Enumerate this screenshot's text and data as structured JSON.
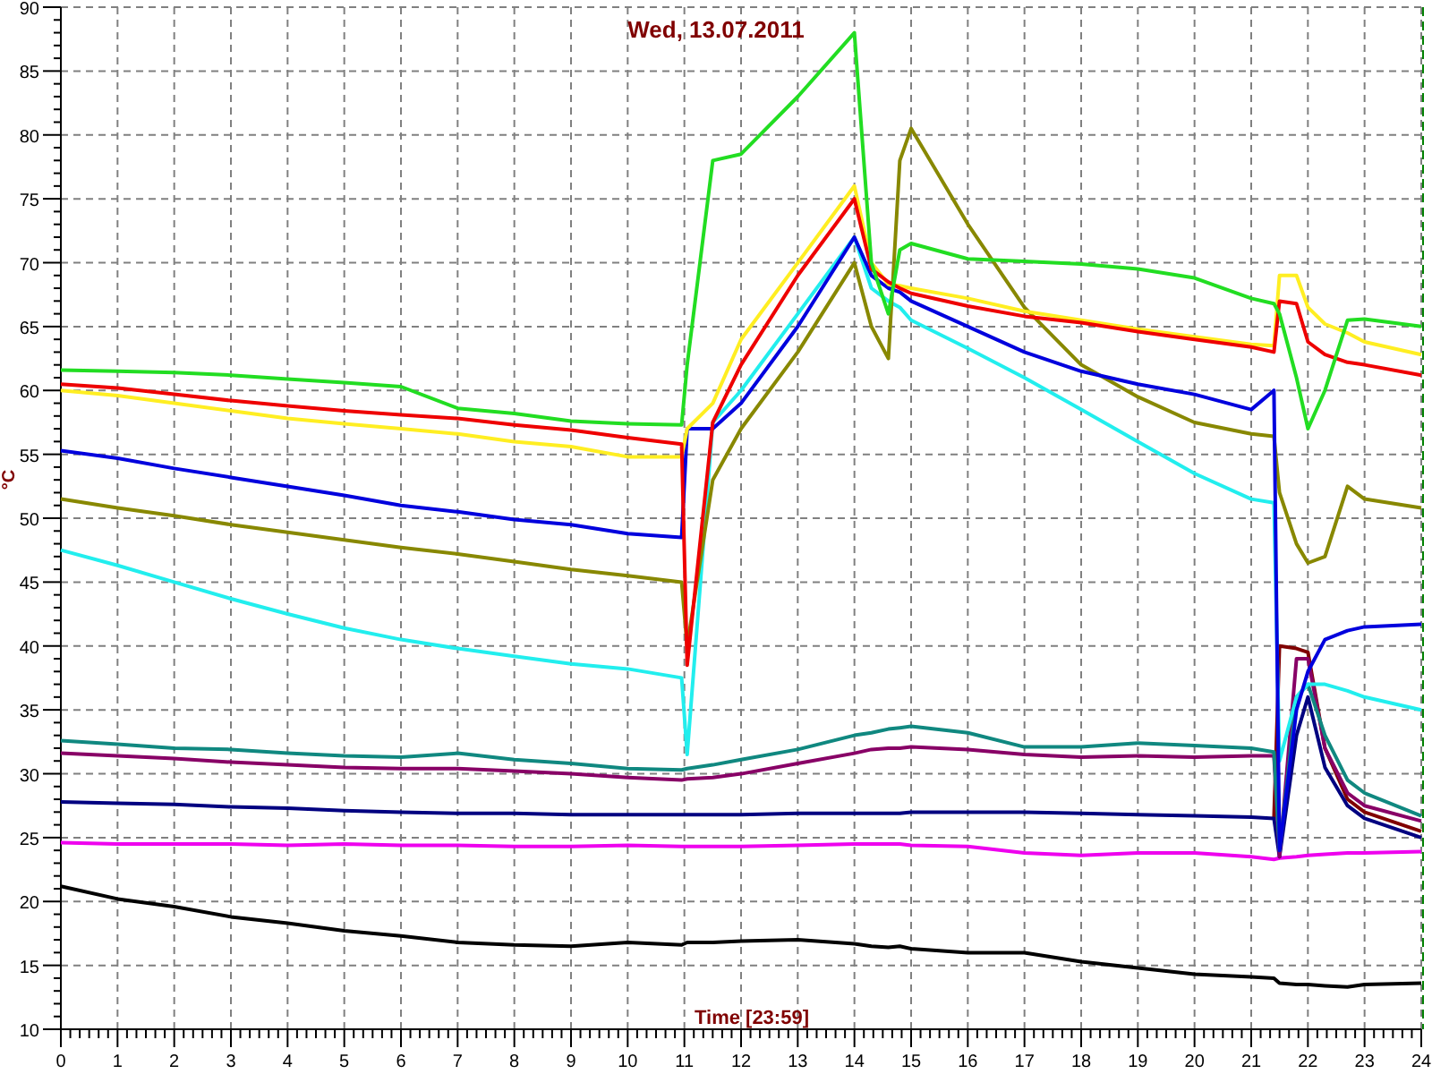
{
  "chart": {
    "chart_data": {
      "type": "line",
      "title": "Wed, 13.07.2011",
      "xlabel": "Time [23:59]",
      "ylabel": "°C",
      "x": [
        0,
        1,
        2,
        3,
        4,
        5,
        6,
        7,
        8,
        9,
        10,
        10.95,
        11.05,
        11.5,
        12,
        13,
        14,
        14.3,
        14.6,
        14.8,
        15,
        16,
        17,
        18,
        19,
        20,
        21,
        21.4,
        21.5,
        21.8,
        22,
        22.3,
        22.7,
        23,
        24
      ],
      "grid": true,
      "xlim": [
        0,
        24
      ],
      "ylim": [
        10,
        90
      ],
      "xticks": [
        0,
        1,
        2,
        3,
        4,
        5,
        6,
        7,
        8,
        9,
        10,
        11,
        12,
        13,
        14,
        15,
        16,
        17,
        18,
        19,
        20,
        21,
        22,
        23,
        24
      ],
      "yticks": [
        10,
        15,
        20,
        25,
        30,
        35,
        40,
        45,
        50,
        55,
        60,
        65,
        70,
        75,
        80,
        85,
        90
      ],
      "series": [
        {
          "color": "#000000",
          "values": [
            21.2,
            20.2,
            19.6,
            18.8,
            18.3,
            17.7,
            17.3,
            16.8,
            16.6,
            16.5,
            16.8,
            16.6,
            16.8,
            16.8,
            16.9,
            17,
            16.7,
            16.5,
            16.4,
            16.5,
            16.3,
            16,
            16,
            15.3,
            14.8,
            14.3,
            14.1,
            14,
            13.6,
            13.5,
            13.5,
            13.4,
            13.3,
            13.5,
            13.6
          ]
        },
        {
          "color": "#ee00ee",
          "values": [
            24.6,
            24.5,
            24.5,
            24.5,
            24.4,
            24.5,
            24.4,
            24.4,
            24.3,
            24.3,
            24.4,
            24.3,
            24.3,
            24.3,
            24.3,
            24.4,
            24.5,
            24.5,
            24.5,
            24.5,
            24.4,
            24.3,
            23.8,
            23.6,
            23.8,
            23.8,
            23.5,
            23.3,
            23.4,
            23.5,
            23.6,
            23.7,
            23.8,
            23.8,
            23.9
          ]
        },
        {
          "color": "#800000",
          "values": [
            null,
            null,
            null,
            null,
            null,
            null,
            null,
            null,
            null,
            null,
            null,
            null,
            null,
            null,
            null,
            null,
            null,
            null,
            null,
            null,
            null,
            null,
            null,
            null,
            null,
            null,
            null,
            26.5,
            40,
            39.8,
            39.5,
            32,
            28,
            27,
            25.5
          ]
        },
        {
          "color": "#000080",
          "values": [
            27.8,
            27.7,
            27.6,
            27.4,
            27.3,
            27.1,
            27,
            26.9,
            26.9,
            26.8,
            26.8,
            26.8,
            26.8,
            26.8,
            26.8,
            26.9,
            26.9,
            26.9,
            26.9,
            26.9,
            27,
            27,
            27,
            26.9,
            26.8,
            26.7,
            26.6,
            26.5,
            23.5,
            33,
            36,
            30.5,
            27.5,
            26.5,
            25
          ]
        },
        {
          "color": "#880066",
          "values": [
            31.6,
            31.4,
            31.2,
            30.9,
            30.7,
            30.5,
            30.4,
            30.4,
            30.2,
            30,
            29.7,
            29.5,
            29.6,
            29.7,
            30,
            30.8,
            31.6,
            31.9,
            32,
            32,
            32.1,
            31.9,
            31.5,
            31.3,
            31.4,
            31.3,
            31.4,
            31.4,
            23.5,
            39,
            39,
            32,
            28.5,
            27.5,
            26.3
          ]
        },
        {
          "color": "#108880",
          "values": [
            32.6,
            32.3,
            32,
            31.9,
            31.6,
            31.4,
            31.3,
            31.6,
            31.1,
            30.8,
            30.4,
            30.3,
            30.4,
            30.7,
            31.1,
            31.9,
            33,
            33.2,
            33.5,
            33.6,
            33.7,
            33.2,
            32.1,
            32.1,
            32.4,
            32.2,
            32,
            31.7,
            24,
            36,
            37,
            33,
            29.5,
            28.5,
            26.7
          ]
        },
        {
          "color": "#22eeee",
          "values": [
            47.5,
            46.3,
            45,
            43.7,
            42.5,
            41.4,
            40.5,
            39.8,
            39.2,
            38.6,
            38.2,
            37.5,
            31.5,
            57.5,
            60,
            66,
            72,
            68,
            67,
            66.5,
            65.5,
            63.3,
            61,
            58.5,
            56,
            53.5,
            51.5,
            51.2,
            31,
            36,
            37,
            37,
            36.5,
            36,
            35
          ]
        },
        {
          "color": "#888800",
          "values": [
            51.5,
            50.8,
            50.2,
            49.5,
            48.9,
            48.3,
            47.7,
            47.2,
            46.6,
            46,
            45.5,
            45,
            40,
            53,
            57,
            63,
            70,
            65,
            62.5,
            78,
            80.5,
            73,
            66.5,
            62,
            59.5,
            57.5,
            56.6,
            56.4,
            52,
            48,
            46.5,
            47,
            52.5,
            51.5,
            50.8
          ]
        },
        {
          "color": "#0000dd",
          "values": [
            55.3,
            54.7,
            53.9,
            53.2,
            52.5,
            51.8,
            51,
            50.5,
            49.9,
            49.5,
            48.8,
            48.5,
            57,
            57,
            59,
            65,
            72,
            69,
            68,
            67.7,
            67,
            65,
            63,
            61.5,
            60.5,
            59.7,
            58.5,
            60,
            24,
            35,
            38,
            40.5,
            41.2,
            41.5,
            41.7
          ]
        },
        {
          "color": "#ffee22",
          "values": [
            60,
            59.6,
            59,
            58.4,
            57.8,
            57.4,
            57,
            56.6,
            56,
            55.6,
            54.8,
            54.8,
            57,
            59,
            64,
            70,
            76,
            70,
            68.3,
            68.2,
            68,
            67.2,
            66.2,
            65.5,
            64.8,
            64.2,
            63.6,
            63.5,
            69,
            69,
            66.5,
            65.2,
            64.5,
            63.8,
            62.8
          ]
        },
        {
          "color": "#ee0000",
          "values": [
            60.5,
            60.2,
            59.7,
            59.2,
            58.8,
            58.4,
            58.1,
            57.8,
            57.3,
            56.9,
            56.3,
            55.8,
            38.5,
            57.5,
            62,
            69,
            75,
            69.5,
            68.5,
            68,
            67.6,
            66.6,
            65.8,
            65.3,
            64.6,
            64,
            63.4,
            63,
            67,
            66.8,
            63.8,
            62.8,
            62.2,
            62,
            61.2
          ]
        },
        {
          "color": "#22dd22",
          "values": [
            61.6,
            61.5,
            61.4,
            61.2,
            60.9,
            60.6,
            60.3,
            58.6,
            58.2,
            57.6,
            57.4,
            57.3,
            62,
            78,
            78.5,
            83,
            88,
            70,
            66,
            71,
            71.5,
            70.3,
            70.1,
            69.9,
            69.5,
            68.8,
            67.2,
            66.8,
            66,
            61,
            57,
            60,
            65.5,
            65.6,
            65
          ]
        }
      ]
    }
  }
}
